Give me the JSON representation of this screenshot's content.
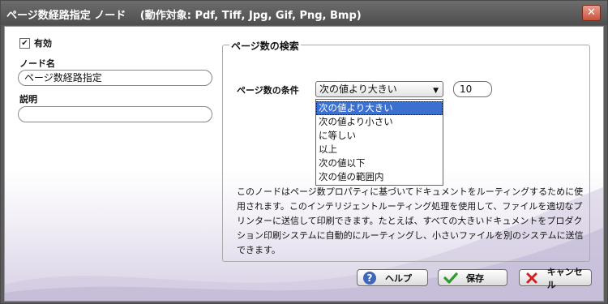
{
  "window": {
    "title": "ページ数経路指定 ノード　 (動作対象: Pdf, Tiff, Jpg, Gif, Png, Bmp)",
    "close_glyph": "✕"
  },
  "left": {
    "enabled_label": "有効",
    "enabled_checked": true,
    "node_name_label": "ノード名",
    "node_name_value": "ページ数経路指定",
    "description_label": "説明",
    "description_value": ""
  },
  "group": {
    "title": "ページ数の検索",
    "condition_label": "ページ数の条件",
    "condition_selected": "次の値より大きい",
    "value": "10",
    "options": [
      "次の値より大きい",
      "次の値より小さい",
      "に等しい",
      "以上",
      "次の値以下",
      "次の値の範囲内"
    ],
    "description": "このノードはページ数プロパティに基づいてドキュメントをルーティングするために使用されます。このインテリジェントルーティング処理を使用して、ファイルを適切なプリンターに送信して印刷できます。たとえば、すべての大きいドキュメントをプロダクション印刷システムに自動的にルーティングし、小さいファイルを別のシステムに送信できます。"
  },
  "buttons": {
    "help": "ヘルプ",
    "save": "保存",
    "cancel": "キャンセル"
  },
  "icons": {
    "help": "help-icon",
    "save": "check-icon",
    "cancel": "x-icon"
  },
  "colors": {
    "title_bar": "#555555",
    "selection": "#3b6fd0",
    "help_icon": "#3f66b8",
    "save_icon": "#2f9a2f",
    "cancel_icon": "#d42020"
  }
}
